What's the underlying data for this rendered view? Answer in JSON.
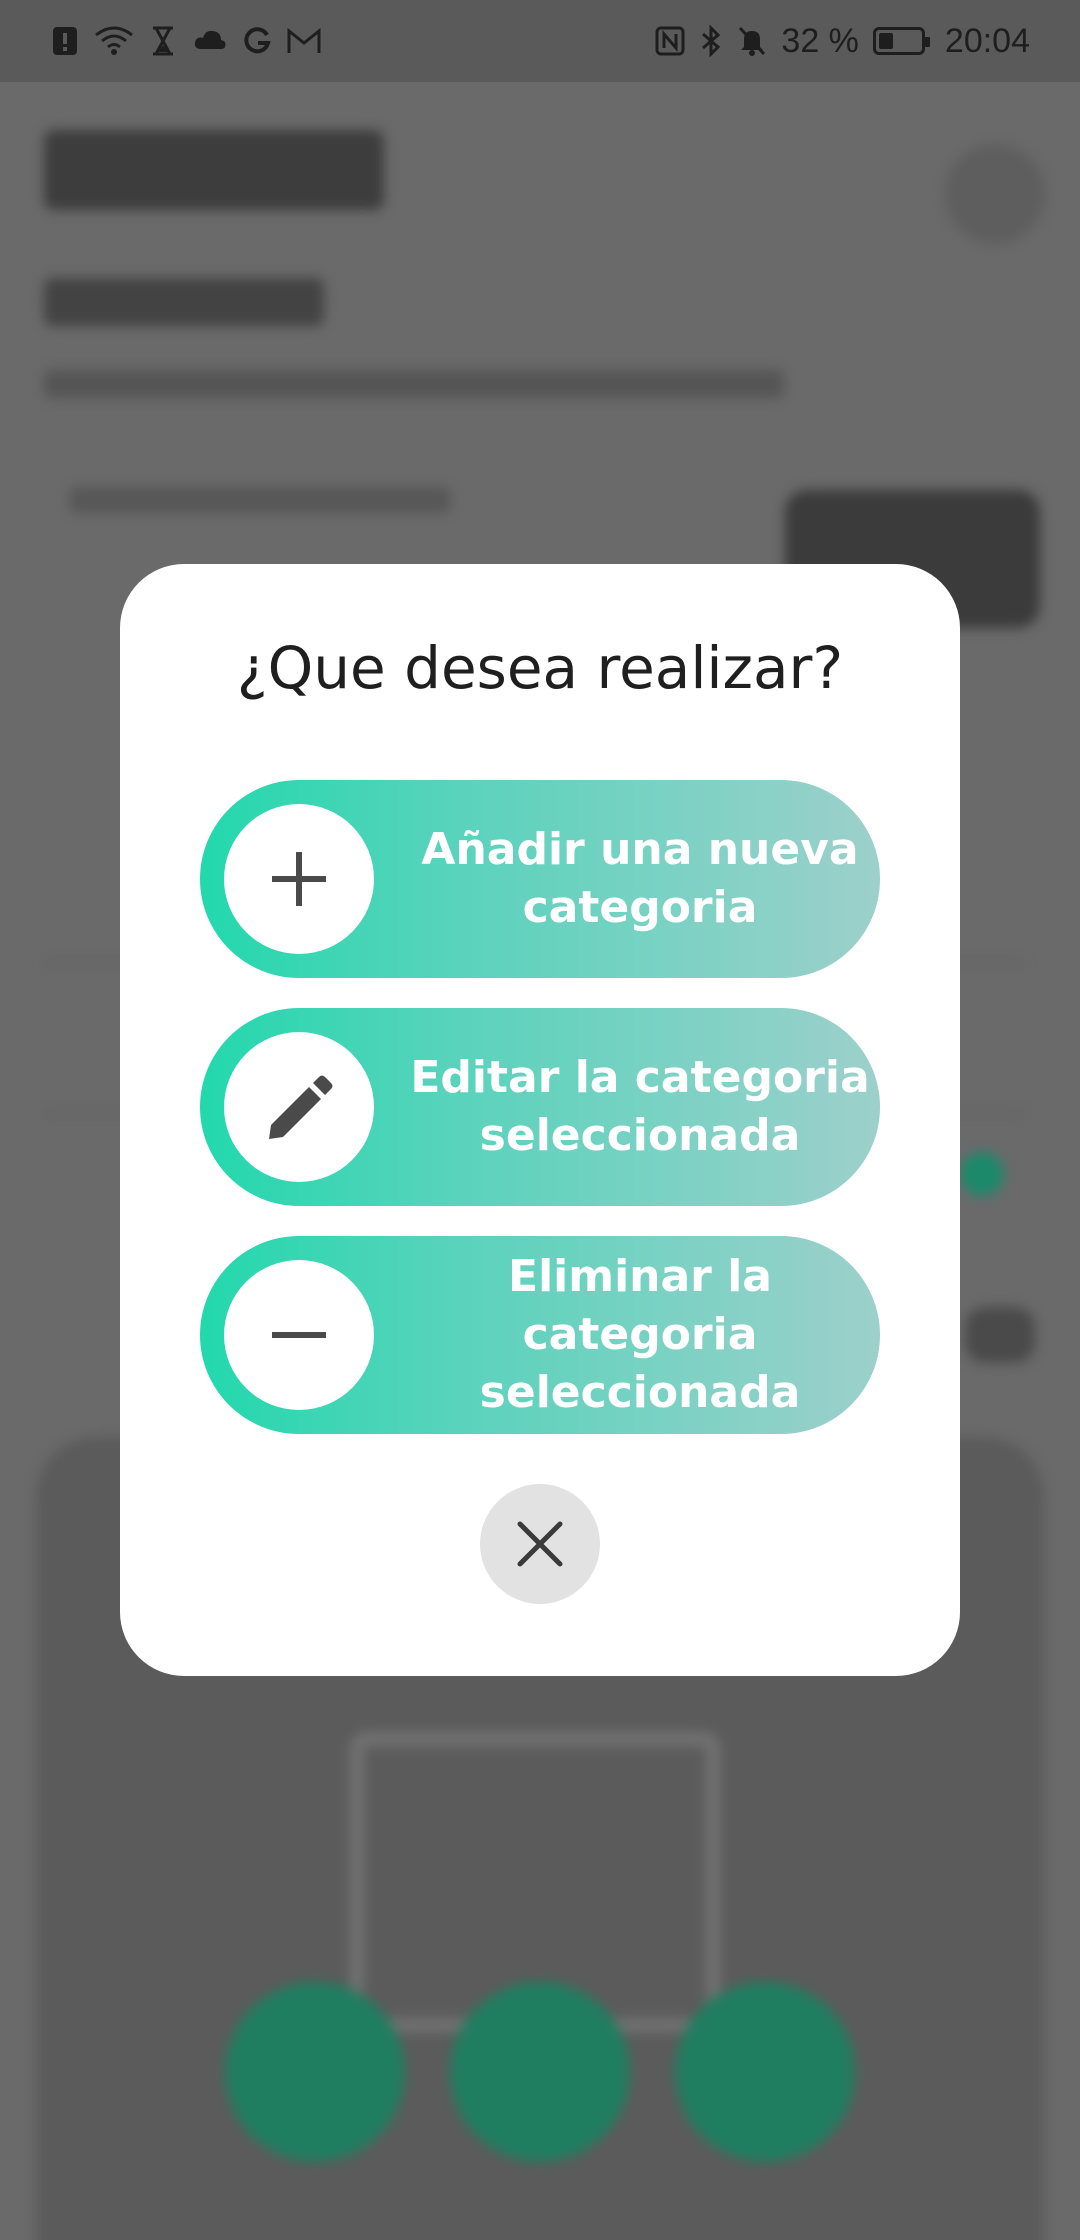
{
  "status_bar": {
    "battery_percent": "32 %",
    "time": "20:04",
    "left_icons": [
      "alert-icon",
      "wifi-icon",
      "hourglass-icon",
      "cloud-icon",
      "google-icon",
      "gmail-icon"
    ],
    "right_icons": [
      "nfc-icon",
      "bluetooth-icon",
      "bell-off-icon",
      "battery-icon"
    ]
  },
  "dialog": {
    "title": "¿Que desea realizar?",
    "options": [
      {
        "label": "Añadir una nueva\ncategoria",
        "icon": "plus-icon"
      },
      {
        "label": "Editar la categoria\nseleccionada",
        "icon": "pencil-icon"
      },
      {
        "label": "Eliminar la categoria\nseleccionada",
        "icon": "minus-icon"
      }
    ],
    "close_icon": "close-icon"
  },
  "colors": {
    "accent_start": "#22d8ac",
    "accent_end": "#9dd0cb",
    "icon_dark": "#4a4a4a",
    "dialog_bg": "#ffffff",
    "scrim": "#6b6b6b"
  }
}
